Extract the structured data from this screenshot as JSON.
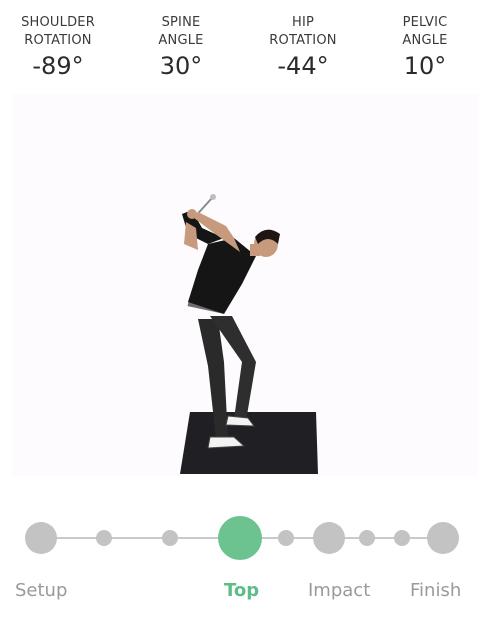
{
  "metrics": [
    {
      "label": "SHOULDER\nROTATION",
      "value": "-89°"
    },
    {
      "label": "SPINE\nANGLE",
      "value": "30°"
    },
    {
      "label": "HIP\nROTATION",
      "value": "-44°"
    },
    {
      "label": "PELVIC\nANGLE",
      "value": "10°"
    }
  ],
  "timeline": {
    "phases": [
      "Setup",
      "Top",
      "Impact",
      "Finish"
    ],
    "active_phase": "Top",
    "accent_color": "#6dc38f",
    "inactive_color": "#c3c3c3"
  }
}
